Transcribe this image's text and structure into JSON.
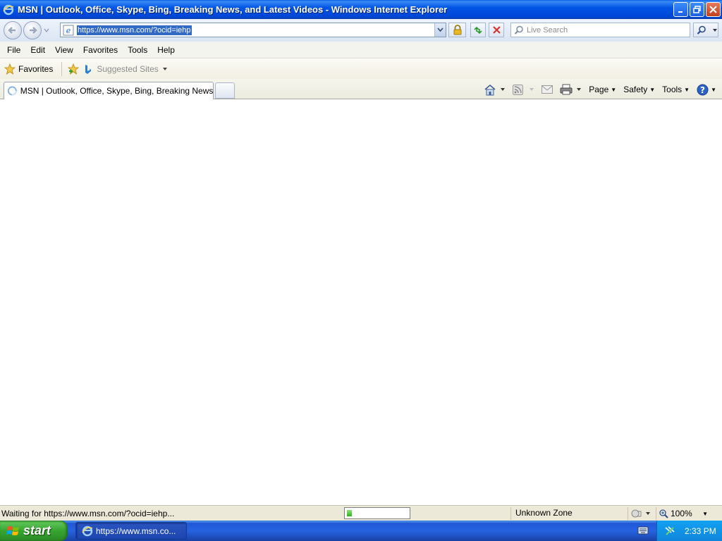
{
  "window": {
    "title": "MSN | Outlook, Office, Skype, Bing, Breaking News, and Latest Videos - Windows Internet Explorer"
  },
  "address_bar": {
    "url": "https://www.msn.com/?ocid=iehp"
  },
  "search": {
    "placeholder": "Live Search"
  },
  "menu": {
    "items": [
      "File",
      "Edit",
      "View",
      "Favorites",
      "Tools",
      "Help"
    ]
  },
  "favorites_bar": {
    "favorites_label": "Favorites",
    "suggested_sites_label": "Suggested Sites"
  },
  "tabs": {
    "active_tab_label": "MSN | Outlook, Office, Skype, Bing, Breaking News, a..."
  },
  "command_bar": {
    "page_label": "Page",
    "safety_label": "Safety",
    "tools_label": "Tools"
  },
  "status_bar": {
    "status_text": "Waiting for https://www.msn.com/?ocid=iehp...",
    "progress_fraction": 0.08,
    "zone_label": "Unknown Zone",
    "zoom_level": "100%"
  },
  "taskbar": {
    "start_label": "start",
    "task_item_label": "https://www.msn.co...",
    "clock": "2:33 PM"
  },
  "colors": {
    "titlebar_blue": "#0055e5",
    "start_green": "#36a530",
    "tray_blue": "#0f86dc",
    "progress_green": "#2db51b"
  }
}
